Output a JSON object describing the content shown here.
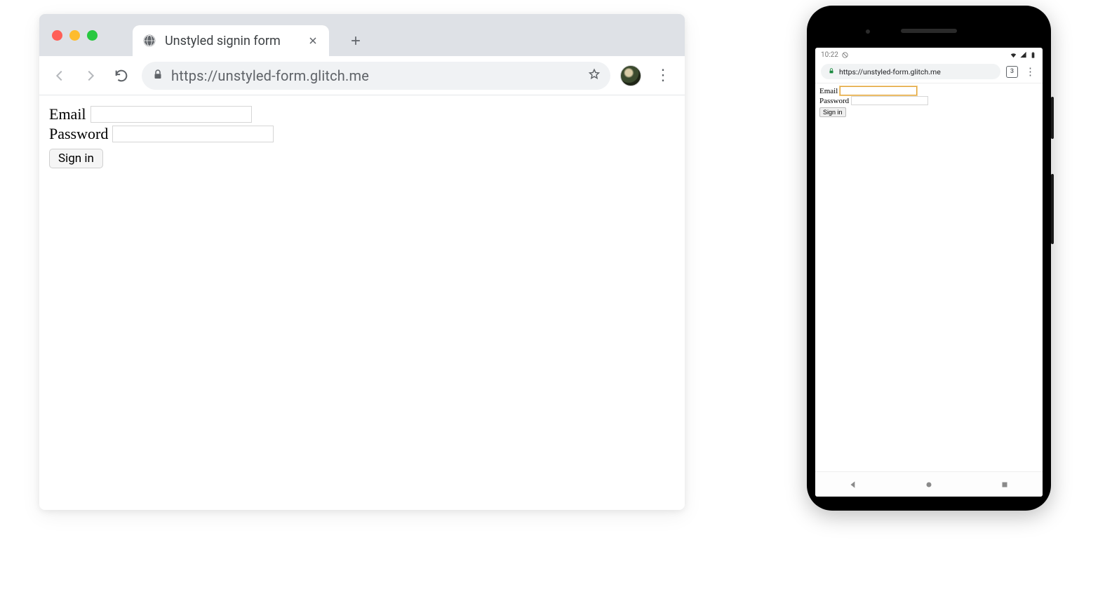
{
  "desktop": {
    "tab": {
      "title": "Unstyled signin form"
    },
    "url": "https://unstyled-form.glitch.me",
    "form": {
      "email_label": "Email",
      "password_label": "Password",
      "submit_label": "Sign in"
    }
  },
  "phone": {
    "status": {
      "time": "10:22"
    },
    "url": "https://unstyled-form.glitch.me",
    "tabs_count": "3",
    "form": {
      "email_label": "Email",
      "password_label": "Password",
      "submit_label": "Sign in"
    }
  }
}
